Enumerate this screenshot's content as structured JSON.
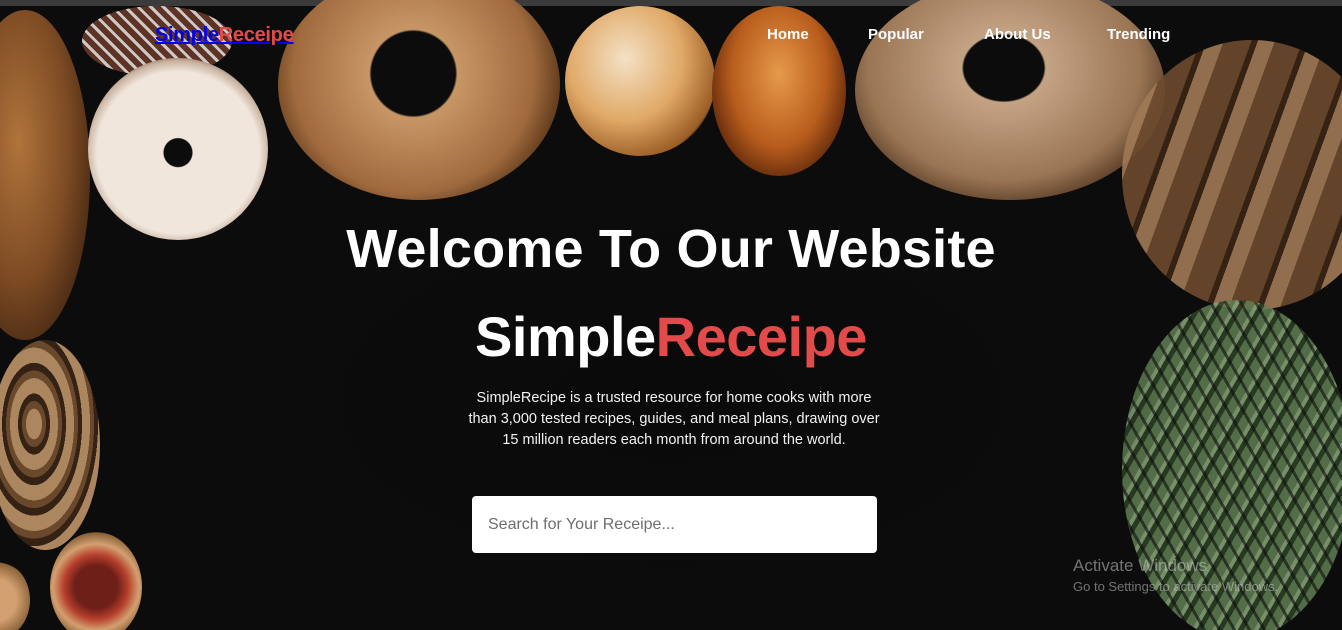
{
  "brand": {
    "part1": "Simple",
    "part2": "Receipe"
  },
  "nav": [
    {
      "label": "Home"
    },
    {
      "label": "Popular"
    },
    {
      "label": "About Us"
    },
    {
      "label": "Trending"
    }
  ],
  "hero": {
    "title": "Welcome To Our Website",
    "brand_part1": "Simple",
    "brand_part2": "Receipe",
    "description": "SimpleRecipe is a trusted resource for home cooks with more than 3,000 tested recipes, guides, and meal plans, drawing over 15 million readers each month from around the world."
  },
  "search": {
    "placeholder": "Search for Your Receipe...",
    "value": ""
  },
  "watermark": {
    "title": "Activate Windows",
    "subtitle": "Go to Settings to activate Windows."
  },
  "colors": {
    "accent": "#e34b4b",
    "background": "#0c0c0c",
    "text": "#ffffff"
  }
}
